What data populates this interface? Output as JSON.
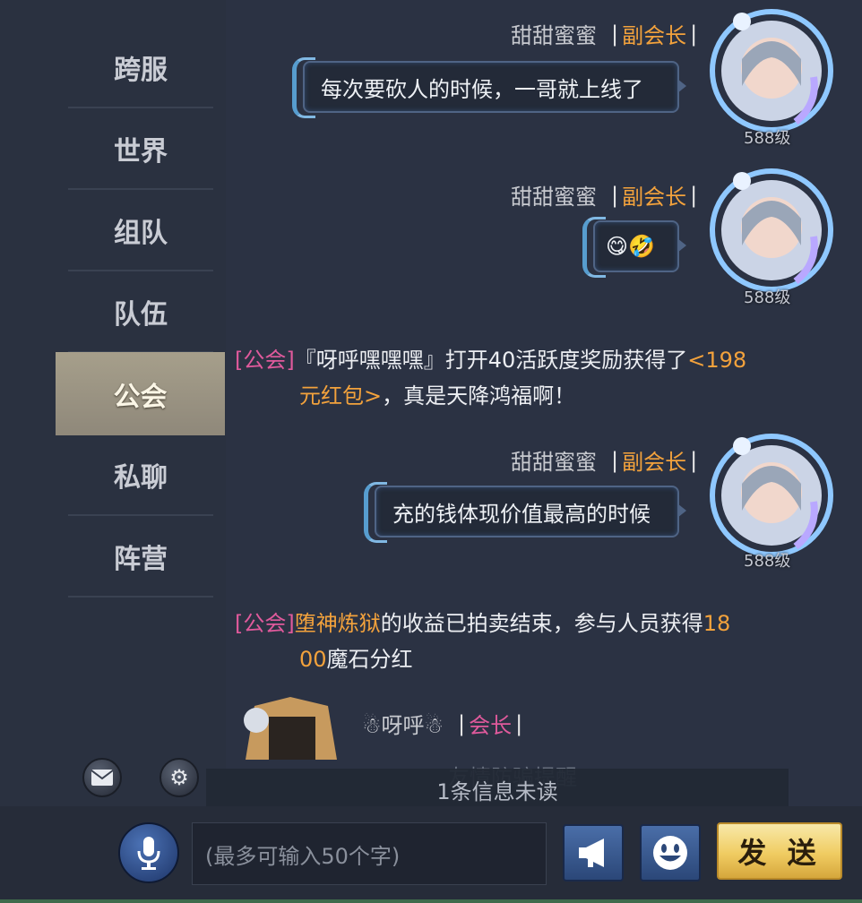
{
  "sidebar": {
    "tabs": [
      "跨服",
      "世界",
      "组队",
      "队伍",
      "公会",
      "私聊",
      "阵营"
    ],
    "active_tab": "公会",
    "mail_icon": "mail-icon",
    "settings_icon": "gear-icon"
  },
  "chat": {
    "messages": [
      {
        "name": "甜甜蜜蜜",
        "rank": "副会长",
        "text": "每次要砍人的时候，一哥就上线了",
        "level": "588级"
      },
      {
        "name": "甜甜蜜蜜",
        "rank": "副会长",
        "text": "😋🤣",
        "level": "588级"
      },
      {
        "name": "甜甜蜜蜜",
        "rank": "副会长",
        "text": "充的钱体现价值最高的时候",
        "level": "588级"
      }
    ],
    "system1": {
      "tag": "[公会]",
      "part1": "『呀呼嘿嘿嘿』打开40活跃度奖励获得了",
      "hl1": "<198",
      "hl2": "元红包>",
      "part2": "，真是天降鸿福啊！"
    },
    "system2": {
      "tag": "[公会]",
      "hl1": "堕神炼狱",
      "part1": "的收益已拍卖结束，参与人员获得",
      "hl2": "18",
      "hl3": "00",
      "part2": "魔石分红"
    },
    "last_sender": {
      "name": "☃呀呼☃",
      "rank": "会长"
    },
    "faded_tip": "友情防骗提醒",
    "unread": "1条信息未读"
  },
  "input": {
    "placeholder": "(最多可输入50个字)",
    "send_label": "发 送"
  },
  "colors": {
    "rank": "#f3a23c",
    "guild_tag": "#e05a9c",
    "highlight": "#f3a23c"
  }
}
